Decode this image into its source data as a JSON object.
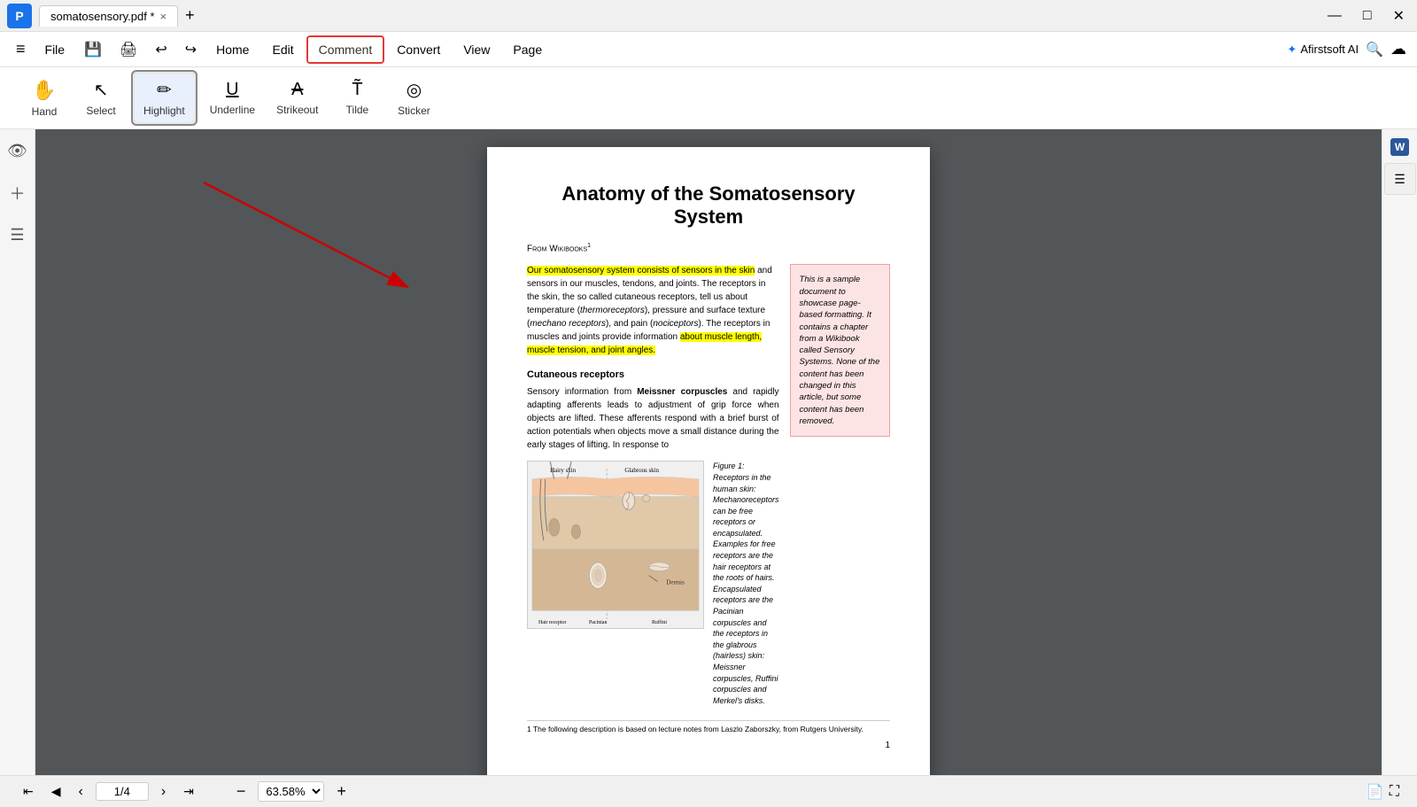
{
  "titlebar": {
    "tab_name": "somatosensory.pdf *",
    "close_label": "×",
    "add_tab_label": "+",
    "win_min": "—",
    "win_max": "□",
    "win_close": "✕"
  },
  "menubar": {
    "hamburger": "≡",
    "file_label": "File",
    "save_icon": "💾",
    "print_icon": "🖨",
    "undo_icon": "↩",
    "redo_icon": "↪",
    "nav_items": [
      "Home",
      "Edit",
      "Comment",
      "Convert",
      "View",
      "Page"
    ],
    "active_nav": "Comment",
    "ai_label": "Afirstsoft AI",
    "ai_icon": "✦"
  },
  "toolbar": {
    "tools": [
      {
        "id": "hand",
        "icon": "✋",
        "label": "Hand"
      },
      {
        "id": "select",
        "icon": "↖",
        "label": "Select"
      },
      {
        "id": "highlight",
        "icon": "✏",
        "label": "Highlight",
        "active": true
      },
      {
        "id": "underline",
        "icon": "U̲",
        "label": "Underline"
      },
      {
        "id": "strikeout",
        "icon": "Ā",
        "label": "Strikeout"
      },
      {
        "id": "tilde",
        "icon": "T",
        "label": "Tilde"
      },
      {
        "id": "sticker",
        "icon": "◎",
        "label": "Sticker"
      }
    ]
  },
  "sidebar_left": {
    "icons": [
      "👁",
      "+",
      "☰"
    ]
  },
  "pdf": {
    "title": "Anatomy of the Somatosensory System",
    "source": "From Wikibooks",
    "source_sup": "1",
    "side_box_text": "This is a sample document to showcase page-based formatting. It contains a chapter from a Wikibook called Sensory Systems. None of the content has been changed in this article, but some content has been removed.",
    "paragraph1_highlighted": "Our somatosensory system consists of sensors in the skin",
    "paragraph1_normal": " and sensors in our muscles, tendons, and joints. The receptors in the skin, the so called cutaneous receptors, tell us about temperature (",
    "paragraph1_italic": "thermoreceptors",
    "paragraph1_normal2": "), pressure and surface texture (",
    "paragraph1_italic2": "mechano receptors",
    "paragraph1_normal3": "), and pain (",
    "paragraph1_italic3": "nociceptors",
    "paragraph1_normal4": "). The receptors in muscles and joints provide information ",
    "paragraph1_highlighted2": "about muscle length, muscle tension, and joint angles.",
    "section1_heading": "Cutaneous receptors",
    "section1_body": "Sensory information from Meissner corpuscles and rapidly adapting afferents leads to adjustment of grip force when objects are lifted. These afferents respond with a brief burst of action potentials when objects move a small distance during the early stages of lifting. In response to",
    "figure_caption": "Figure 1:  Receptors in the human skin: Mechanoreceptors can be free receptors or encapsulated. Examples for free receptors are the hair receptors at the roots of hairs. Encapsulated receptors are the Pacinian corpuscles and the receptors in the glabrous (hairless) skin: Meissner corpuscles, Ruffini corpuscles and Merkel's disks.",
    "footnote": "1 The following description is based on lecture notes from Laszlo Zaborszky, from Rutgers University.",
    "page_number": "1"
  },
  "bottombar": {
    "first_page": "⇤",
    "prev_page": "◀",
    "prev_arrow": "‹",
    "next_arrow": "›",
    "last_page": "⇥",
    "page_current": "1/4",
    "zoom_out": "−",
    "zoom_in": "+",
    "zoom_level": "63.58%",
    "doc_icon": "📄",
    "fullscreen_icon": "⛶"
  }
}
